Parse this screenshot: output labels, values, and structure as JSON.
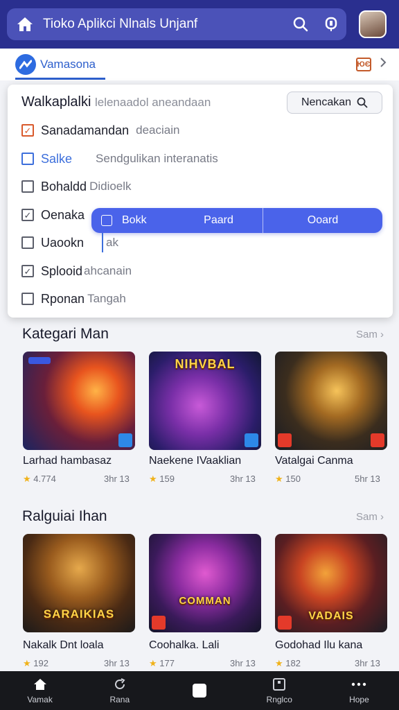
{
  "header": {
    "title": "Tioko Aplikci Nlnals Unjanf"
  },
  "subheader": {
    "brand": "Vamasona",
    "badge": "ЮЄ"
  },
  "filter_panel": {
    "title": "Walkaplalki",
    "subtitle": "lelenaadol aneandaan",
    "button_label": "Nencakan",
    "options": [
      {
        "label": "Sanadamandan",
        "desc": "deaciain",
        "checked": true,
        "style": "orange"
      },
      {
        "label": "Salke",
        "desc": "Sendgulikan interanatis",
        "checked": false,
        "style": "blue"
      },
      {
        "label": "Bohaldd",
        "desc": "Didioelk",
        "checked": false,
        "style": "normal"
      },
      {
        "label": "Oenaka",
        "desc": "",
        "checked": true,
        "style": "normal"
      },
      {
        "label": "Uaookn",
        "desc": "ak",
        "checked": false,
        "style": "normal"
      },
      {
        "label": "Splooid",
        "desc": "ahcanain",
        "checked": true,
        "style": "normal"
      },
      {
        "label": "Rponan",
        "desc": "Tangah",
        "checked": false,
        "style": "normal"
      }
    ],
    "segments": [
      "Bokk",
      "Paard",
      "Ooard"
    ]
  },
  "sections": [
    {
      "title": "Kategari Man",
      "more": "Sam",
      "games": [
        {
          "name": "Larhad hambasaz",
          "rating": "4.774",
          "size": "3hr 13",
          "art_text": ""
        },
        {
          "name": "Naekene IVaaklian",
          "rating": "159",
          "size": "3hr 13",
          "art_text": "NIHVBAL"
        },
        {
          "name": "Vatalgai Canma",
          "rating": "150",
          "size": "5hr 13",
          "art_text": ""
        }
      ]
    },
    {
      "title": "Ralguiai Ihan",
      "more": "Sam",
      "games": [
        {
          "name": "Nakalk Dnt loala",
          "rating": "192",
          "size": "3hr 13",
          "art_text": "SARAIKIAS"
        },
        {
          "name": "Coohalka. Lali",
          "rating": "177",
          "size": "3hr 13",
          "art_text": "COMMAN"
        },
        {
          "name": "Godohad Ilu kana",
          "rating": "182",
          "size": "3hr 13",
          "art_text": "VADAIS"
        }
      ]
    }
  ],
  "bottom_nav": [
    {
      "label": "Vamak",
      "icon": "home-icon"
    },
    {
      "label": "Rana",
      "icon": "refresh-icon"
    },
    {
      "label": "",
      "icon": "square-icon"
    },
    {
      "label": "Rnglco",
      "icon": "frame-icon"
    },
    {
      "label": "Hope",
      "icon": "more-icon"
    }
  ]
}
